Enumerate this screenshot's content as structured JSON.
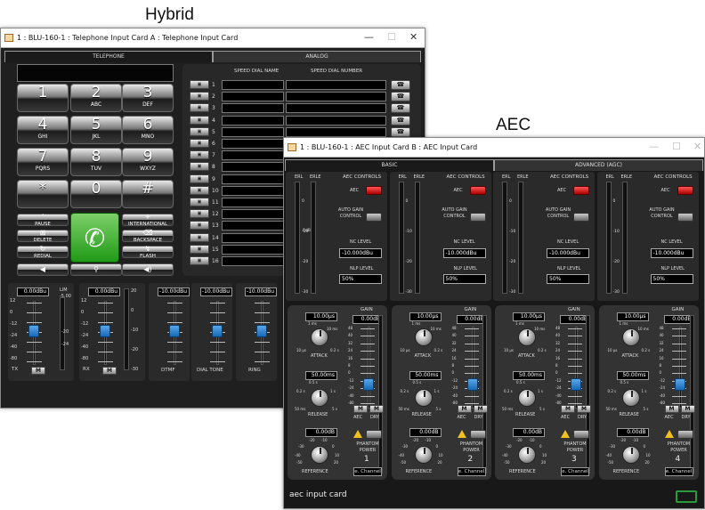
{
  "labels": {
    "hybrid": "Hybrid",
    "aec": "AEC"
  },
  "telephone_window": {
    "title": "1 : BLU-160-1 : Telephone Input Card A : Telephone Input Card",
    "tabs": [
      "TELEPHONE",
      "ANALOG"
    ],
    "keypad": [
      {
        "digit": "1",
        "letters": ""
      },
      {
        "digit": "2",
        "letters": "ABC"
      },
      {
        "digit": "3",
        "letters": "DEF"
      },
      {
        "digit": "4",
        "letters": "GHI"
      },
      {
        "digit": "5",
        "letters": "JKL"
      },
      {
        "digit": "6",
        "letters": "MNO"
      },
      {
        "digit": "7",
        "letters": "PQRS"
      },
      {
        "digit": "8",
        "letters": "TUV"
      },
      {
        "digit": "9",
        "letters": "WXYZ"
      },
      {
        "digit": "*",
        "letters": ""
      },
      {
        "digit": "0",
        "letters": ""
      },
      {
        "digit": "#",
        "letters": ""
      }
    ],
    "function_keys": {
      "pause": "PAUSE",
      "international": "INTERNATIONAL",
      "delete": "DELETE",
      "backspace": "BACKSPACE",
      "redial": "REDIAL",
      "flash": "FLASH"
    },
    "speed_dial": {
      "name_header": "SPEED DIAL NAME",
      "number_header": "SPEED DIAL NUMBER",
      "rows": [
        "1",
        "2",
        "3",
        "4",
        "5",
        "6",
        "7",
        "8",
        "9",
        "10",
        "11",
        "12",
        "13",
        "14",
        "15",
        "16"
      ]
    },
    "channels": [
      {
        "label": "TX",
        "level": "0.00dBu"
      },
      {
        "label": "RX",
        "level": "0.00dBu"
      },
      {
        "label": "DTMF",
        "level": "-10.00dBu"
      },
      {
        "label": "DIAL TONE",
        "level": "-10.00dBu"
      },
      {
        "label": "RING",
        "level": "-10.00dBu"
      }
    ],
    "fader_scale": [
      "12",
      "0",
      "-12",
      "-24",
      "-40",
      "-80"
    ],
    "meter_scale": [
      "20",
      "0",
      "-10",
      "-20",
      "-30"
    ],
    "lim_label": "LIM",
    "lim_value": "-5.00",
    "lim_scale": [
      "-20",
      "-24"
    ],
    "mute_label": "M"
  },
  "aec_window": {
    "title": "1 : BLU-160-1 : AEC Input Card B : AEC Input Card",
    "tabs": [
      "BASIC",
      "ADVANCED (AGC)"
    ],
    "footer_label": "aec input card",
    "labels": {
      "erl": "ERL",
      "erle": "ERLE",
      "aec_controls": "AEC CONTROLS",
      "aec": "AEC",
      "auto_gain_control": "AUTO GAIN CONTROL",
      "nc_level": "NC LEVEL",
      "nlp_level": "NLP LEVEL",
      "gain": "GAIN",
      "attack": "ATTACK",
      "release": "RELEASE",
      "reference": "REFERENCE",
      "aec_mode": "AEC",
      "dry": "DRY",
      "phantom_power": "PHANTOM POWER",
      "channel_link": "e. Channel"
    },
    "meter_scale": [
      "0",
      "-10",
      "-20",
      "-30"
    ],
    "meter_mid": "0dB",
    "gain_scale": [
      "48",
      "40",
      "32",
      "24",
      "16",
      "8",
      "0",
      "-12",
      "-24",
      "-40",
      "-80"
    ],
    "attack_scale": [
      "1 ms",
      "10 ms",
      "10 µs",
      "0.2 s"
    ],
    "release_scale": [
      "0.5 s",
      "0.2 s",
      "1 s",
      "50 ms",
      "5 s"
    ],
    "reference_scale": [
      "-20",
      "-10",
      "-30",
      "0",
      "-40",
      "10",
      "-50",
      "20"
    ],
    "channels": [
      {
        "number": "1",
        "nc": "-10.000dBu",
        "nlp": "50%",
        "attack": "10.00µs",
        "release": "50.00ms",
        "gain": "0.00dB",
        "reference": "0.00dB"
      },
      {
        "number": "2",
        "nc": "-10.000dBu",
        "nlp": "50%",
        "attack": "10.00µs",
        "release": "50.00ms",
        "gain": "0.00dB",
        "reference": "0.00dB"
      },
      {
        "number": "3",
        "nc": "-10.000dBu",
        "nlp": "50%",
        "attack": "10.00µs",
        "release": "50.00ms",
        "gain": "0.00dB",
        "reference": "0.00dB"
      },
      {
        "number": "4",
        "nc": "-10.000dBu",
        "nlp": "50%",
        "attack": "10.00µs",
        "release": "50.00ms",
        "gain": "0.00dB",
        "reference": "0.00dB"
      }
    ],
    "mute_label": "M"
  }
}
